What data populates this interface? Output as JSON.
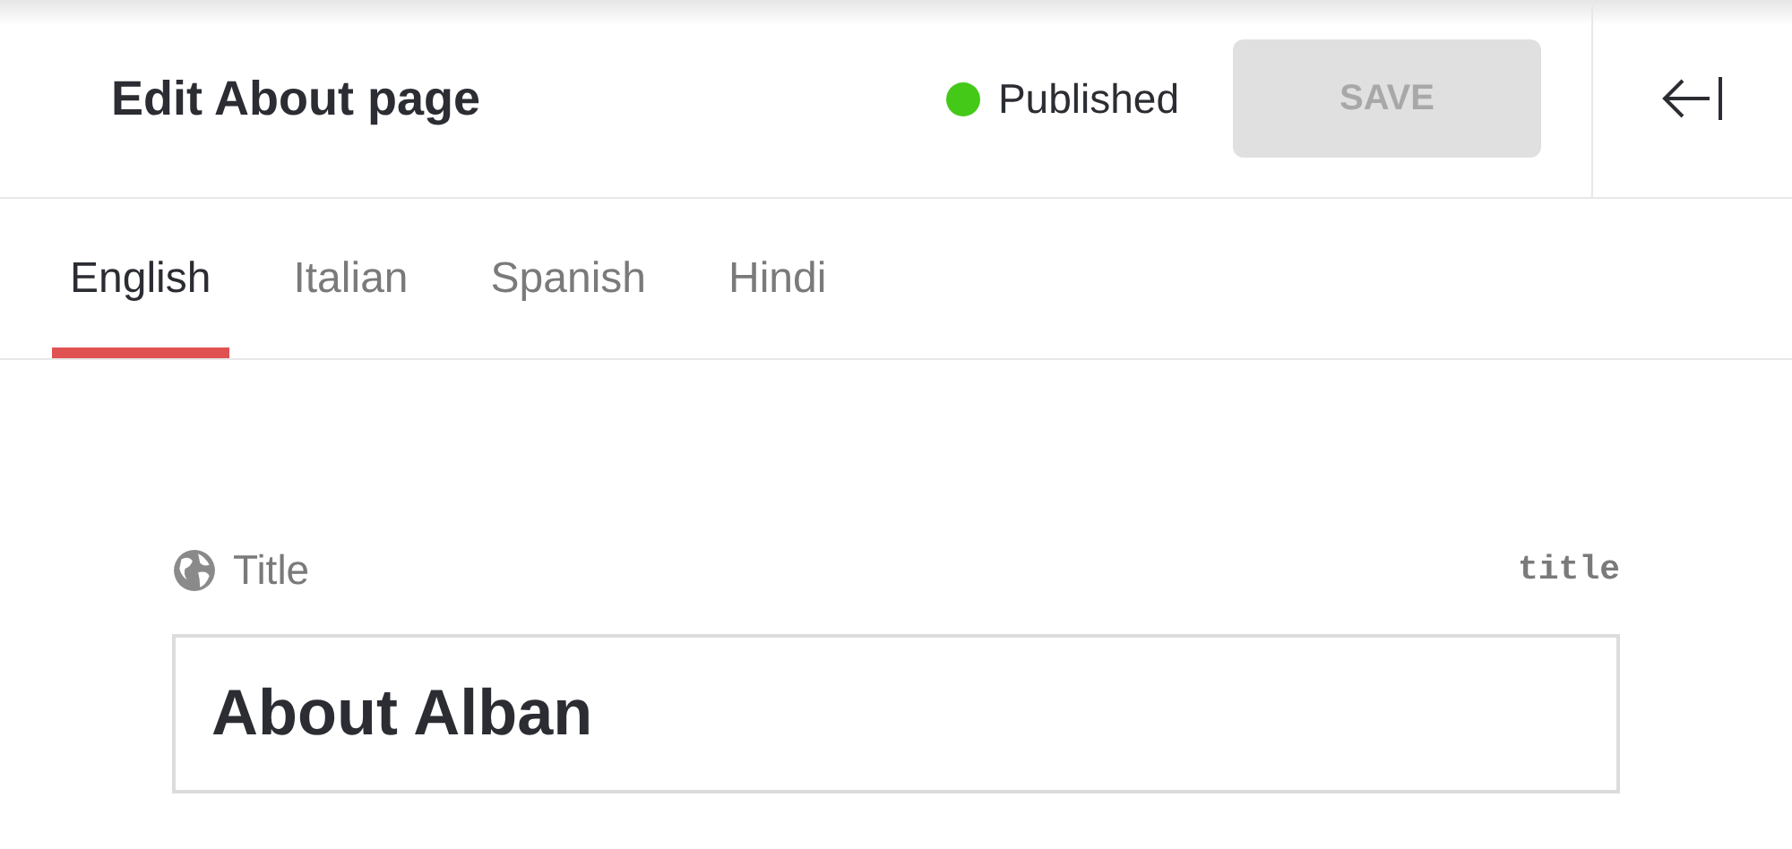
{
  "header": {
    "title": "Edit About page",
    "status": {
      "label": "Published",
      "color": "#44c919"
    },
    "save_button": {
      "label": "SAVE",
      "disabled": true
    }
  },
  "tabs": [
    {
      "label": "English",
      "selected": true
    },
    {
      "label": "Italian",
      "selected": false
    },
    {
      "label": "Spanish",
      "selected": false
    },
    {
      "label": "Hindi",
      "selected": false
    }
  ],
  "field": {
    "label": "Title",
    "key": "title",
    "value": "About Alban"
  }
}
